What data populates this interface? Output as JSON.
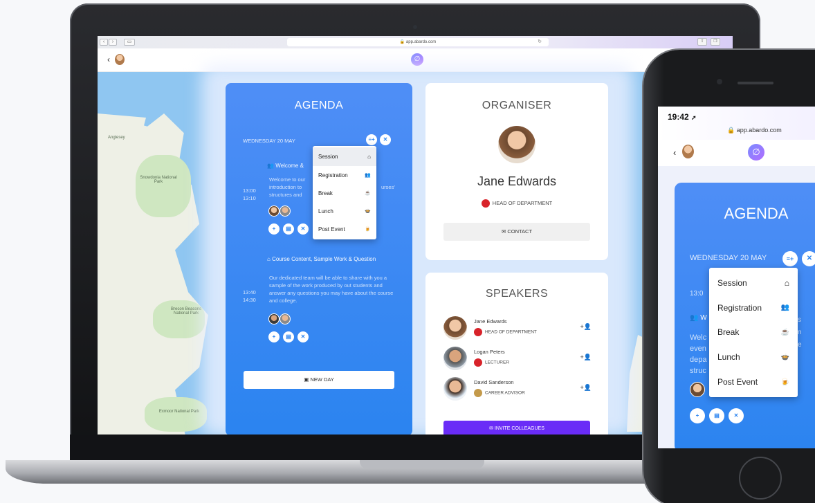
{
  "browser": {
    "url": "app.abardo.com",
    "nav_back": "‹",
    "nav_fwd": "›"
  },
  "app": {
    "logo_glyph": "∅"
  },
  "map": {
    "labels": [
      "Anglesey",
      "Snowdonia National Park",
      "Brecon Beacons National Park",
      "Exmoor National Park"
    ]
  },
  "agenda": {
    "title": "AGENDA",
    "day": "WEDNESDAY 20 MAY",
    "events": [
      {
        "title": "Welcome & ",
        "desc": [
          "Welcome to our",
          "introduction to",
          "structures and"
        ],
        "desc_tail": "urses'",
        "time_start": "13:00",
        "time_end": "13:10"
      },
      {
        "title": "Course Content, Sample Work & Question",
        "desc": "Our dedicated team will be able to share with you a sample of the work produced by out students and answer any questions you may have about the course and college.",
        "time_start": "13:40",
        "time_end": "14:30"
      }
    ],
    "new_day": "NEW DAY"
  },
  "menu": {
    "items": [
      {
        "label": "Session",
        "icon": "presentation-icon",
        "glyph": "⌂"
      },
      {
        "label": "Registration",
        "icon": "group-icon",
        "glyph": "👥"
      },
      {
        "label": "Break",
        "icon": "coffee-icon",
        "glyph": "☕"
      },
      {
        "label": "Lunch",
        "icon": "bowl-icon",
        "glyph": "🍲"
      },
      {
        "label": "Post Event",
        "icon": "pub-icon",
        "glyph": "🍺"
      }
    ]
  },
  "organiser": {
    "title": "ORGANISER",
    "name": "Jane Edwards",
    "role": "HEAD OF DEPARTMENT",
    "contact": "CONTACT"
  },
  "speakers": {
    "title": "SPEAKERS",
    "list": [
      {
        "name": "Jane Edwards",
        "role": "HEAD OF DEPARTMENT"
      },
      {
        "name": "Logan Peters",
        "role": "LECTURER"
      },
      {
        "name": "David Sanderson",
        "role": "CAREER ADVISOR"
      }
    ],
    "invite": "INVITE COLLEAGUES"
  },
  "phone": {
    "time": "19:42",
    "url": "app.abardo.com",
    "agenda_title": "AGENDA",
    "day": "WEDNESDAY 20 MAY",
    "time_partial": "13:0",
    "welcome_partial": "W",
    "desc_partial": [
      "Welc",
      "even",
      "depa",
      "struc"
    ],
    "right_partial": [
      "s",
      "n",
      "e"
    ]
  },
  "colors": {
    "agenda_blue": "#2b84f0",
    "invite_purple": "#6a2cf7",
    "badge_red": "#d8232a"
  }
}
